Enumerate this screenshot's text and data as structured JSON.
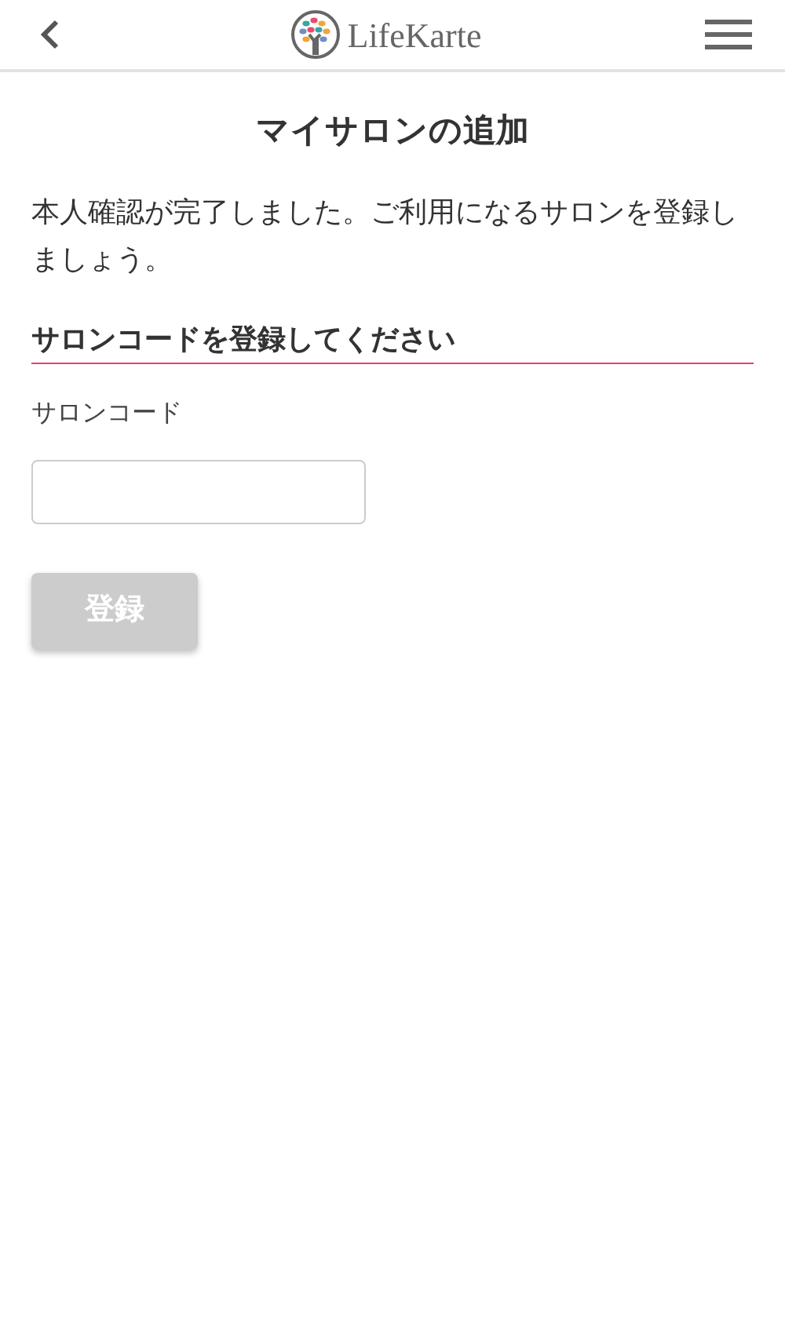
{
  "header": {
    "logo_text": "LifeKarte"
  },
  "page_title": "マイサロンの追加",
  "message": "本人確認が完了しました。ご利用になるサロンを登録しましょう。",
  "section_heading": "サロンコードを登録してください",
  "field": {
    "label": "サロンコード"
  },
  "submit_button": {
    "label": "登録",
    "disabled": true
  }
}
